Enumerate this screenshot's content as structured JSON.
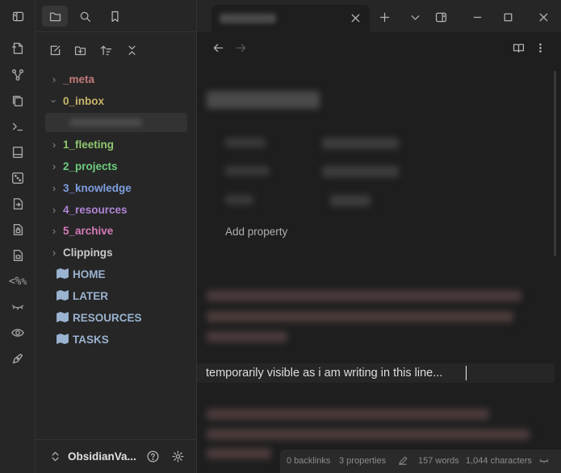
{
  "ribbon": {
    "icons": [
      "new-note-icon",
      "graph-view-icon",
      "copy-files-icon",
      "terminal-icon",
      "book-icon",
      "dice-icon",
      "note-export-icon",
      "lock-file-icon",
      "lock-icon",
      "regex-icon",
      "hidden-eye-icon",
      "eye-icon",
      "pen-icon"
    ],
    "regex_label": "<%"
  },
  "sidebar": {
    "tree": [
      {
        "label": "_meta",
        "type": "folder",
        "color": "#c47a7a",
        "expanded": false
      },
      {
        "label": "0_inbox",
        "type": "folder",
        "color": "#c8b56a",
        "expanded": true
      },
      {
        "label": "1_fleeting",
        "type": "folder",
        "color": "#8fc770",
        "expanded": false
      },
      {
        "label": "2_projects",
        "type": "folder",
        "color": "#6ecb7e",
        "expanded": false
      },
      {
        "label": "3_knowledge",
        "type": "folder",
        "color": "#7e9ee0",
        "expanded": false
      },
      {
        "label": "4_resources",
        "type": "folder",
        "color": "#b084d6",
        "expanded": false
      },
      {
        "label": "5_archive",
        "type": "folder",
        "color": "#d67ab8",
        "expanded": false
      },
      {
        "label": "Clippings",
        "type": "folder",
        "color": "#c8c8c8",
        "expanded": false
      },
      {
        "label": "HOME",
        "type": "map",
        "color": "#9ab3d0"
      },
      {
        "label": "LATER",
        "type": "map",
        "color": "#9ab3d0"
      },
      {
        "label": "RESOURCES",
        "type": "map",
        "color": "#9ab3d0"
      },
      {
        "label": "TASKS",
        "type": "map",
        "color": "#9ab3d0"
      }
    ],
    "vault_name": "ObsidianVa..."
  },
  "editor": {
    "add_property": "Add property",
    "active_line": "temporarily visible as i am writing in this line..."
  },
  "status": {
    "backlinks": "0 backlinks",
    "properties": "3 properties",
    "words": "157 words",
    "characters": "1,044 characters"
  }
}
